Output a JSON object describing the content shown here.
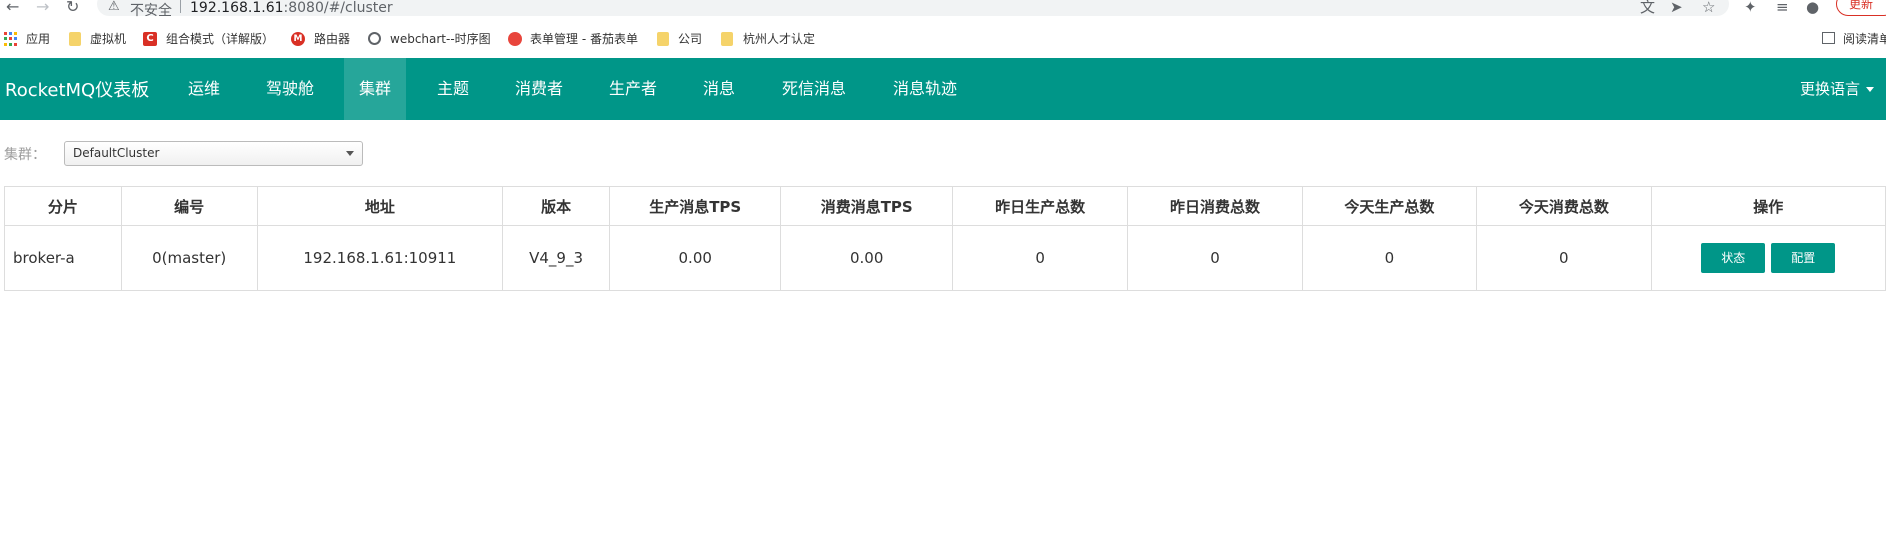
{
  "browser": {
    "url_warning": "不安全",
    "url_host": "192.168.1.61",
    "url_rest": ":8080/#/cluster",
    "update_label": "更新",
    "bookmarks": [
      {
        "label": "应用"
      },
      {
        "label": "虚拟机"
      },
      {
        "label": "组合模式（详解版）"
      },
      {
        "label": "路由器"
      },
      {
        "label": "webchart--时序图"
      },
      {
        "label": "表单管理 - 番茄表单"
      },
      {
        "label": "公司"
      },
      {
        "label": "杭州人才认定"
      }
    ],
    "reading_list": "阅读清单"
  },
  "navbar": {
    "brand": "RocketMQ仪表板",
    "items": [
      {
        "label": "运维"
      },
      {
        "label": "驾驶舱"
      },
      {
        "label": "集群"
      },
      {
        "label": "主题"
      },
      {
        "label": "消费者"
      },
      {
        "label": "生产者"
      },
      {
        "label": "消息"
      },
      {
        "label": "死信消息"
      },
      {
        "label": "消息轨迹"
      }
    ],
    "active": "集群",
    "language": "更换语言"
  },
  "cluster": {
    "label": "集群：",
    "selected": "DefaultCluster"
  },
  "table": {
    "headers": [
      "分片",
      "编号",
      "地址",
      "版本",
      "生产消息TPS",
      "消费消息TPS",
      "昨日生产总数",
      "昨日消费总数",
      "今天生产总数",
      "今天消费总数",
      "操作"
    ],
    "rows": [
      {
        "broker": "broker-a",
        "id": "0(master)",
        "address": "192.168.1.61:10911",
        "version": "V4_9_3",
        "produce_tps": "0.00",
        "consume_tps": "0.00",
        "yesterday_produce": "0",
        "yesterday_consume": "0",
        "today_produce": "0",
        "today_consume": "0",
        "status_label": "状态",
        "config_label": "配置"
      }
    ]
  },
  "colors": {
    "accent": "#009688",
    "nav_active": "#26a69a"
  }
}
